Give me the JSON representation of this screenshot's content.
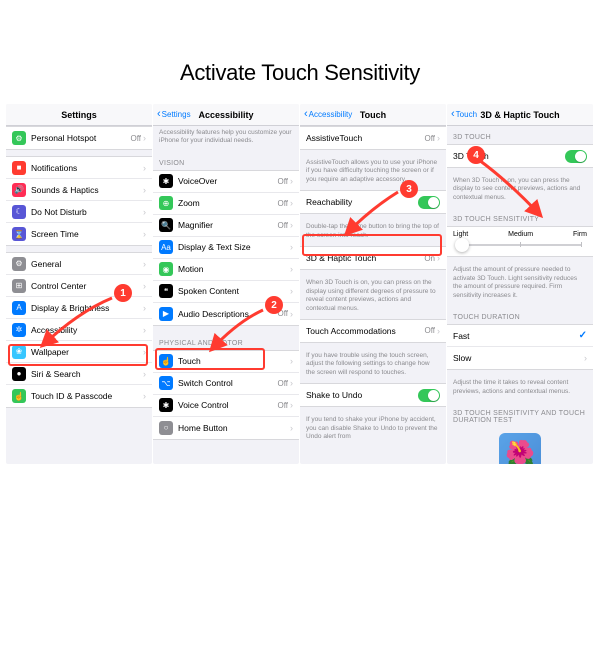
{
  "title": "Activate Touch Sensitivity",
  "steps": [
    "1",
    "2",
    "3",
    "4"
  ],
  "screen1": {
    "nav_title": "Settings",
    "rows_a": [
      {
        "icon": "#34c759",
        "glyph": "⚙",
        "label": "Personal Hotspot",
        "value": "Off"
      }
    ],
    "rows_b": [
      {
        "icon": "#ff3b30",
        "glyph": "■",
        "label": "Notifications"
      },
      {
        "icon": "#ff2d55",
        "glyph": "🔊",
        "label": "Sounds & Haptics"
      },
      {
        "icon": "#5856d6",
        "glyph": "☾",
        "label": "Do Not Disturb"
      },
      {
        "icon": "#5856d6",
        "glyph": "⌛",
        "label": "Screen Time"
      }
    ],
    "rows_c": [
      {
        "icon": "#8e8e93",
        "glyph": "⚙",
        "label": "General"
      },
      {
        "icon": "#8e8e93",
        "glyph": "⊞",
        "label": "Control Center"
      },
      {
        "icon": "#007aff",
        "glyph": "A",
        "label": "Display & Brightness"
      },
      {
        "icon": "#007aff",
        "glyph": "✲",
        "label": "Accessibility",
        "hl": true
      },
      {
        "icon": "#36c6ff",
        "glyph": "❀",
        "label": "Wallpaper"
      },
      {
        "icon": "#000",
        "glyph": "●",
        "label": "Siri & Search"
      },
      {
        "icon": "#34c759",
        "glyph": "☝",
        "label": "Touch ID & Passcode"
      }
    ]
  },
  "screen2": {
    "nav_back": "Settings",
    "nav_title": "Accessibility",
    "intro": "Accessibility features help you customize your iPhone for your individual needs.",
    "sec_vision": "VISION",
    "rows_vision": [
      {
        "icon": "#000",
        "glyph": "✱",
        "label": "VoiceOver",
        "value": "Off"
      },
      {
        "icon": "#34c759",
        "glyph": "⊕",
        "label": "Zoom",
        "value": "Off"
      },
      {
        "icon": "#000",
        "glyph": "🔍",
        "label": "Magnifier",
        "value": "Off"
      },
      {
        "icon": "#007aff",
        "glyph": "Aa",
        "label": "Display & Text Size"
      },
      {
        "icon": "#34c759",
        "glyph": "◉",
        "label": "Motion"
      },
      {
        "icon": "#000",
        "glyph": "❝",
        "label": "Spoken Content"
      },
      {
        "icon": "#007aff",
        "glyph": "▶",
        "label": "Audio Descriptions",
        "value": "Off"
      }
    ],
    "sec_motor": "PHYSICAL AND MOTOR",
    "rows_motor": [
      {
        "icon": "#007aff",
        "glyph": "☝",
        "label": "Touch",
        "hl": true
      },
      {
        "icon": "#007aff",
        "glyph": "⌥",
        "label": "Switch Control",
        "value": "Off"
      },
      {
        "icon": "#000",
        "glyph": "✱",
        "label": "Voice Control",
        "value": "Off"
      },
      {
        "icon": "#8e8e93",
        "glyph": "○",
        "label": "Home Button"
      }
    ]
  },
  "screen3": {
    "nav_back": "Accessibility",
    "nav_title": "Touch",
    "rows": [
      {
        "label": "AssistiveTouch",
        "value": "Off",
        "chev": true,
        "foot": "AssistiveTouch allows you to use your iPhone if you have difficulty touching the screen or if you require an adaptive accessory."
      },
      {
        "label": "Reachability",
        "toggle": "on",
        "foot": "Double-tap the home button to bring the top of the screen into reach."
      },
      {
        "label": "3D & Haptic Touch",
        "value": "On",
        "chev": true,
        "hl": true,
        "foot": "When 3D Touch is on, you can press on the display using different degrees of pressure to reveal content previews, actions and contextual menus."
      },
      {
        "label": "Touch Accommodations",
        "value": "Off",
        "chev": true,
        "foot": "If you have trouble using the touch screen, adjust the following settings to change how the screen will respond to touches."
      },
      {
        "label": "Shake to Undo",
        "toggle": "on",
        "foot": "If you tend to shake your iPhone by accident, you can disable Shake to Undo to prevent the Undo alert from"
      }
    ]
  },
  "screen4": {
    "nav_back": "Touch",
    "nav_title": "3D & Haptic Touch",
    "sec1": "3D TOUCH",
    "row1": {
      "label": "3D Touch",
      "toggle": "on"
    },
    "foot1": "When 3D Touch is on, you can press the display to see content previews, actions and contextual menus.",
    "sec2": "3D TOUCH SENSITIVITY",
    "slider": {
      "labels": [
        "Light",
        "Medium",
        "Firm"
      ],
      "pos": 0
    },
    "foot2": "Adjust the amount of pressure needed to activate 3D Touch. Light sensitivity reduces the amount of pressure required. Firm sensitivity increases it.",
    "sec3": "TOUCH DURATION",
    "rows3": [
      {
        "label": "Fast",
        "check": true
      },
      {
        "label": "Slow"
      }
    ],
    "foot3": "Adjust the time it takes to reveal content previews, actions and contextual menus.",
    "sec4": "3D TOUCH SENSITIVITY AND TOUCH DURATION TEST"
  }
}
